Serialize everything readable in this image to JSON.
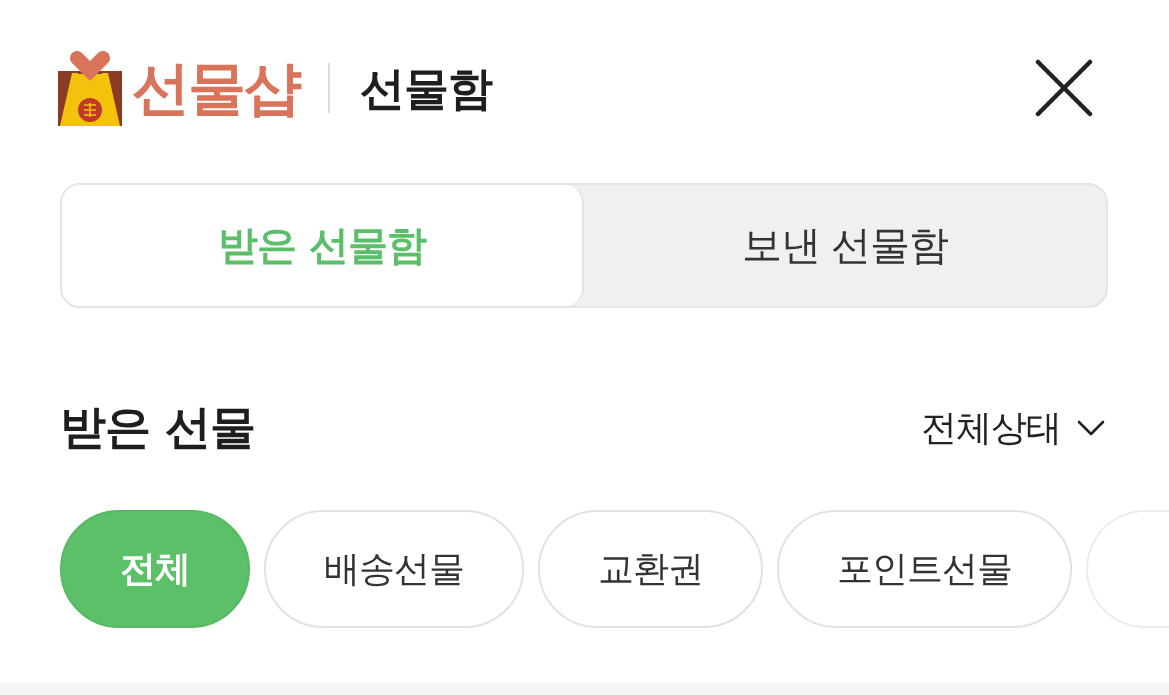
{
  "header": {
    "brand": "선물샵",
    "title": "선물함"
  },
  "tabs": [
    {
      "label": "받은 선물함",
      "selected": true
    },
    {
      "label": "보낸 선물함",
      "selected": false
    }
  ],
  "section": {
    "title": "받은 선물",
    "filter": "전체상태"
  },
  "chips": [
    {
      "label": "전체",
      "selected": true
    },
    {
      "label": "배송선물",
      "selected": false
    },
    {
      "label": "교환권",
      "selected": false
    },
    {
      "label": "포인트선물",
      "selected": false
    }
  ],
  "chips_overflow": true
}
